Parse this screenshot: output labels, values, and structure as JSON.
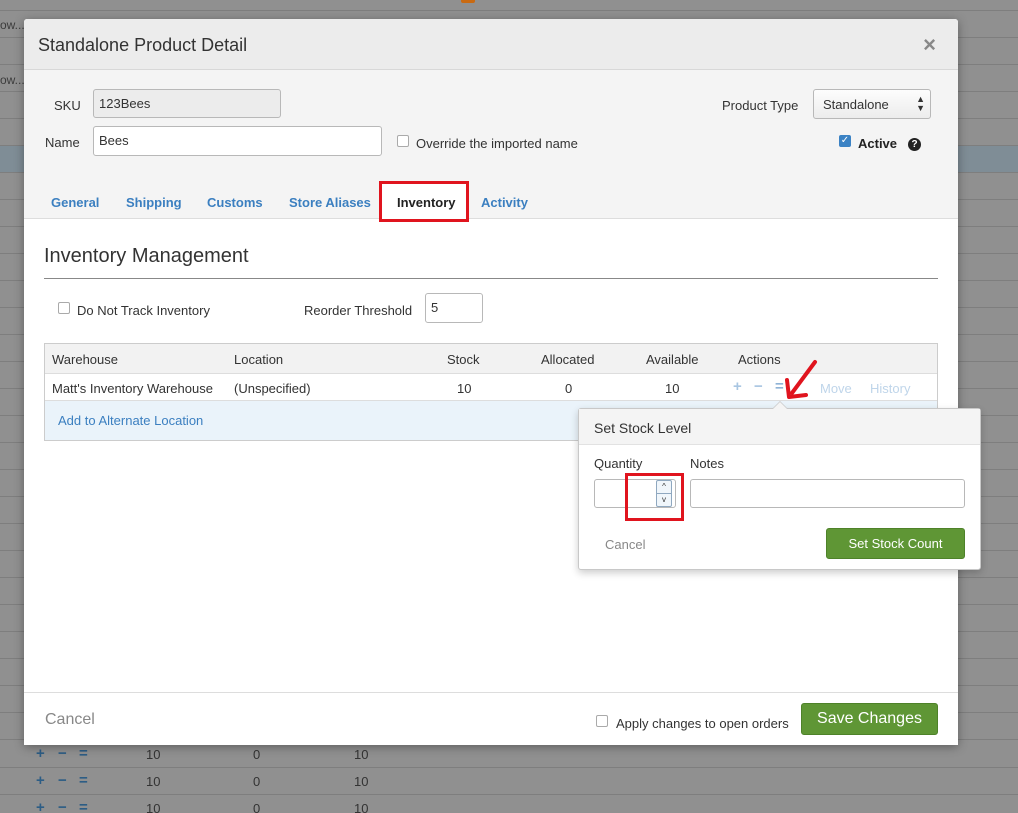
{
  "modal": {
    "title": "Standalone Product Detail",
    "close_icon": "×",
    "sku_label": "SKU",
    "sku_value": "123Bees",
    "name_label": "Name",
    "name_value": "Bees",
    "override_label": "Override the imported name",
    "product_type_label": "Product Type",
    "product_type_value": "Standalone",
    "active_label": "Active",
    "help_icon": "?"
  },
  "tabs": [
    {
      "label": "General"
    },
    {
      "label": "Shipping"
    },
    {
      "label": "Customs"
    },
    {
      "label": "Store Aliases"
    },
    {
      "label": "Inventory",
      "active": true
    },
    {
      "label": "Activity"
    }
  ],
  "inventory": {
    "title": "Inventory Management",
    "do_not_track_label": "Do Not Track Inventory",
    "reorder_label": "Reorder Threshold",
    "reorder_value": "5",
    "columns": [
      "Warehouse",
      "Location",
      "Stock",
      "Allocated",
      "Available",
      "Actions"
    ],
    "rows": [
      {
        "warehouse": "Matt's Inventory Warehouse",
        "location": "(Unspecified)",
        "stock": "10",
        "allocated": "0",
        "available": "10"
      }
    ],
    "actions": {
      "plus": "+",
      "minus": "−",
      "equals": "=",
      "move": "Move",
      "history": "History"
    },
    "add_alternate": "Add to Alternate Location"
  },
  "popover": {
    "title": "Set Stock Level",
    "quantity_label": "Quantity",
    "quantity_value": "",
    "notes_label": "Notes",
    "notes_value": "",
    "spinner_up": "^",
    "spinner_down": "v",
    "cancel_label": "Cancel",
    "submit_label": "Set Stock Count"
  },
  "footer": {
    "cancel_label": "Cancel",
    "apply_label": "Apply changes to open orders",
    "save_label": "Save Changes"
  },
  "background": {
    "left_edge_text": [
      "ow...",
      "ow..."
    ],
    "rows": [
      {
        "stock": "10",
        "allocated": "0",
        "available": "10"
      },
      {
        "stock": "10",
        "allocated": "0",
        "available": "10"
      },
      {
        "stock": "10",
        "allocated": "0",
        "available": "10"
      }
    ]
  },
  "colors": {
    "accent_blue": "#3b7fc0",
    "green_button": "#5f9635",
    "annotation_red": "#e0141e"
  }
}
